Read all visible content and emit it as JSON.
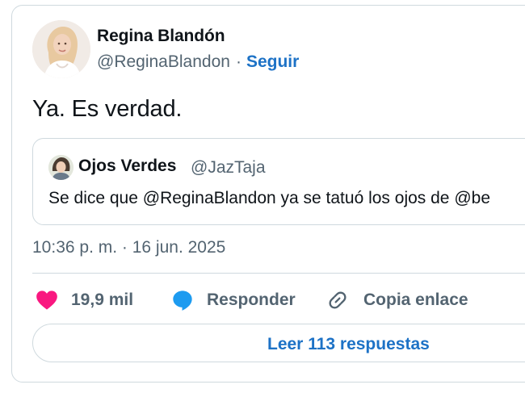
{
  "author": {
    "name": "Regina Blandón",
    "handle": "@ReginaBlandon",
    "separator": "·",
    "follow_label": "Seguir"
  },
  "tweet": {
    "text": "Ya. Es verdad.",
    "timestamp": "10:36 p. m. · 16 jun. 2025"
  },
  "quoted_tweet": {
    "name": "Ojos Verdes",
    "handle": "@JazTaja",
    "text": "Se dice que @ReginaBlandon ya se tatuó los ojos de @be"
  },
  "actions": {
    "likes_count": "19,9 mil",
    "reply_label": "Responder",
    "copy_link_label": "Copia enlace"
  },
  "read_replies_label": "Leer 113 respuestas",
  "colors": {
    "accent": "#1d72c6",
    "like": "#f91880",
    "secondary_text": "#536471",
    "border": "#cfd9de"
  }
}
